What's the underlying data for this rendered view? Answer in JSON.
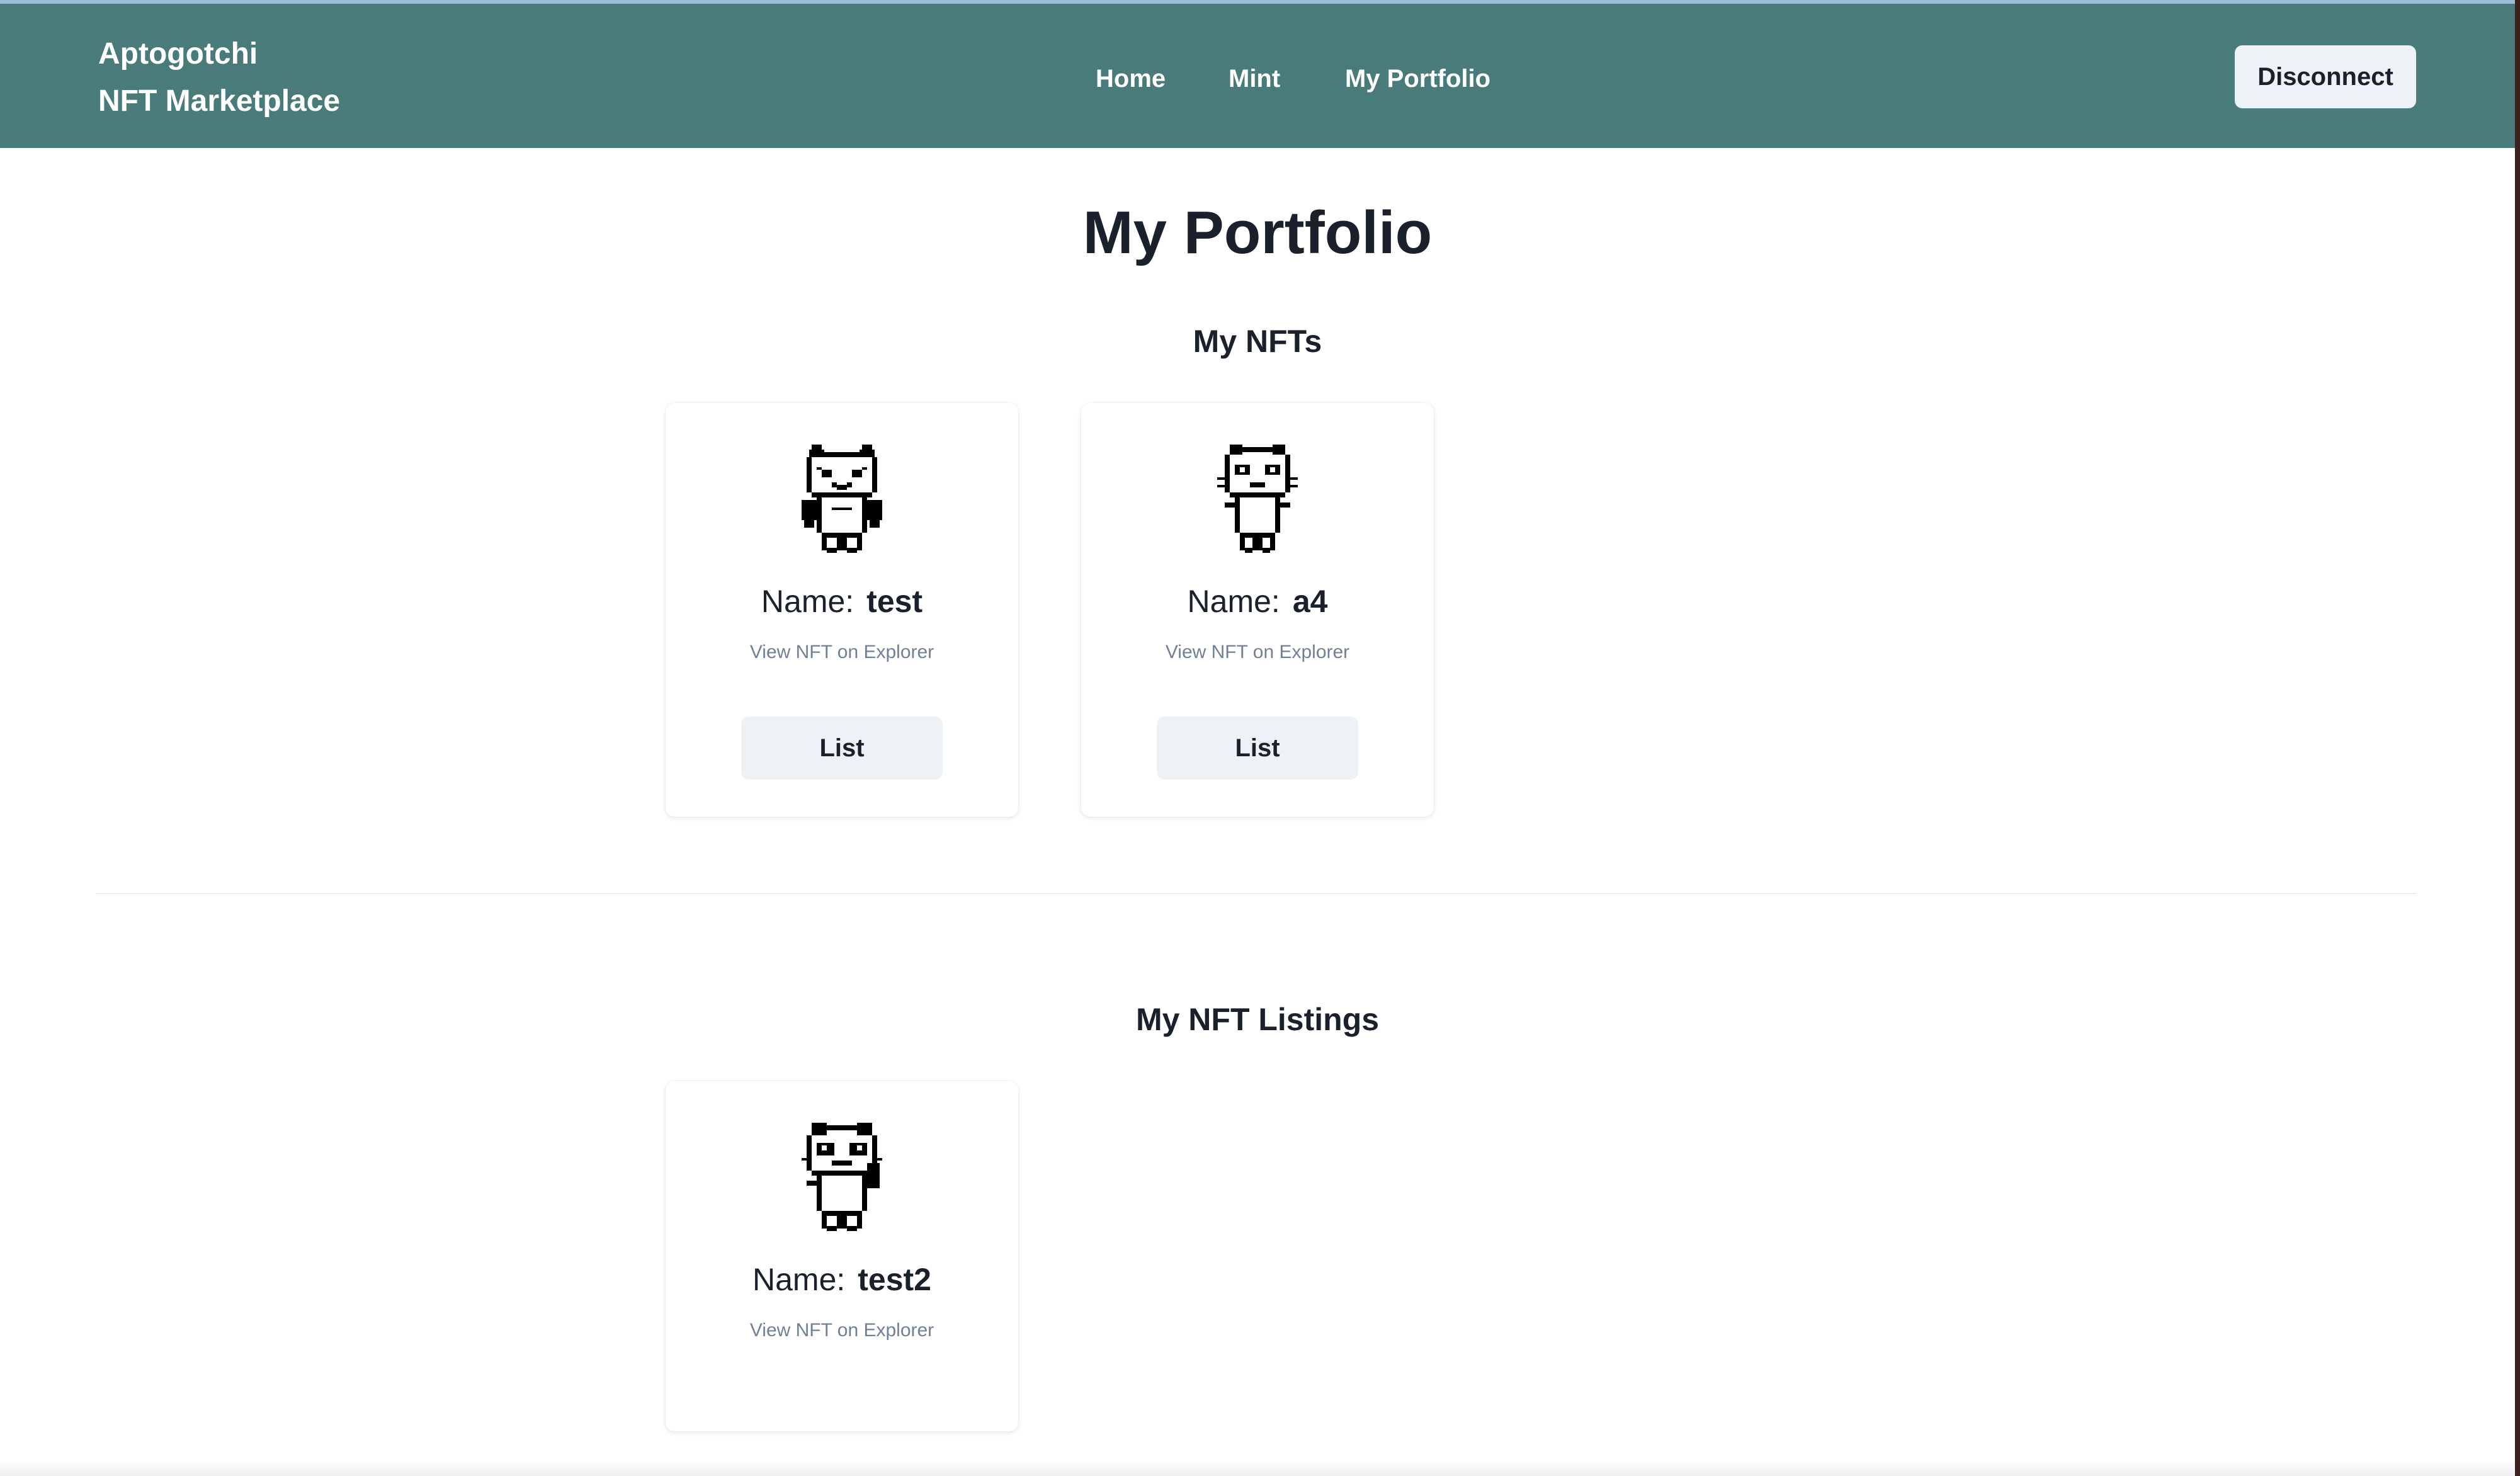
{
  "navbar": {
    "brand_line1": "Aptogotchi",
    "brand_line2": "NFT Marketplace",
    "links": [
      {
        "label": "Home"
      },
      {
        "label": "Mint"
      },
      {
        "label": "My Portfolio"
      }
    ],
    "disconnect_label": "Disconnect",
    "background_color": "#487b7a"
  },
  "page": {
    "title": "My Portfolio"
  },
  "my_nfts": {
    "title": "My NFTs",
    "cards": [
      {
        "name_label": "Name:",
        "name": "test",
        "explorer_link": "View NFT on Explorer",
        "button_label": "List",
        "pet_icon": "pixel-pet-arms-down-icon"
      },
      {
        "name_label": "Name:",
        "name": "a4",
        "explorer_link": "View NFT on Explorer",
        "button_label": "List",
        "pet_icon": "pixel-pet-whiskers-icon"
      }
    ]
  },
  "my_listings": {
    "title": "My NFT Listings",
    "cards": [
      {
        "name_label": "Name:",
        "name": "test2",
        "explorer_link": "View NFT on Explorer",
        "pet_icon": "pixel-pet-waving-icon"
      }
    ]
  }
}
